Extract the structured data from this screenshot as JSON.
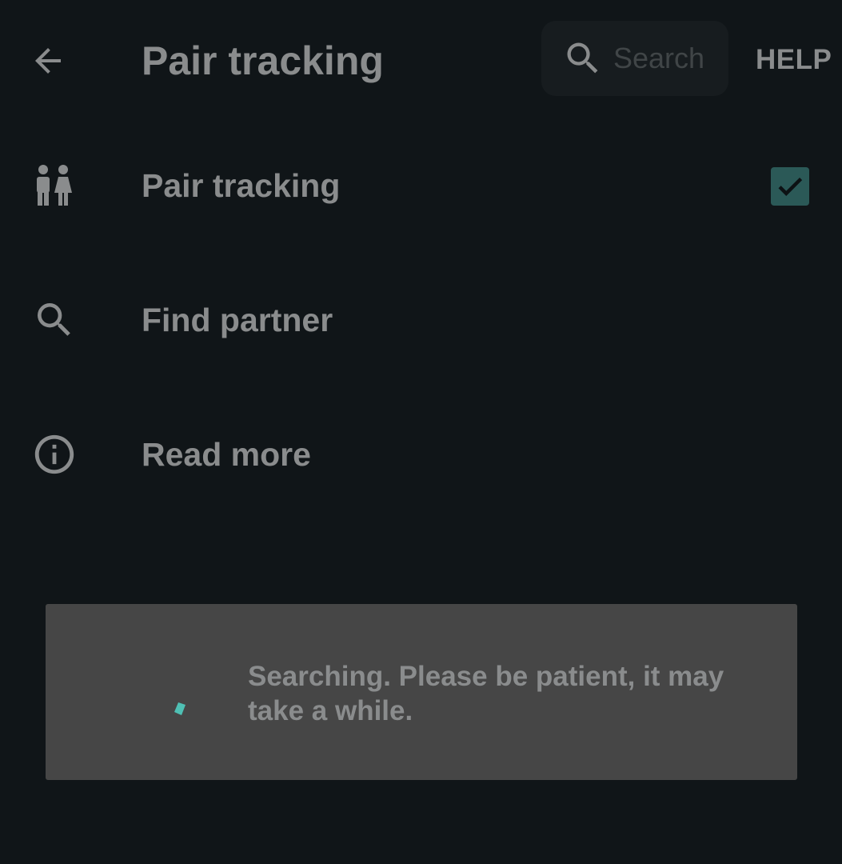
{
  "header": {
    "title": "Pair tracking",
    "back_icon": "arrow-back-icon",
    "search": {
      "placeholder": "Search",
      "value": "",
      "icon": "search-icon"
    },
    "help_label": "HELP"
  },
  "settings": {
    "items": [
      {
        "label": "Pair tracking",
        "icon": "couple-icon",
        "checked": true
      },
      {
        "label": "Find partner",
        "icon": "search-icon"
      },
      {
        "label": "Read more",
        "icon": "info-icon"
      }
    ]
  },
  "dialog": {
    "message": "Searching. Please be patient, it may take a while.",
    "progress_icon": "spinner-icon"
  },
  "colors": {
    "background": "#101518",
    "text": "#8a8c8d",
    "accent": "#2b5957",
    "spinner": "#4fc0b4",
    "dialog_background": "#464646"
  }
}
